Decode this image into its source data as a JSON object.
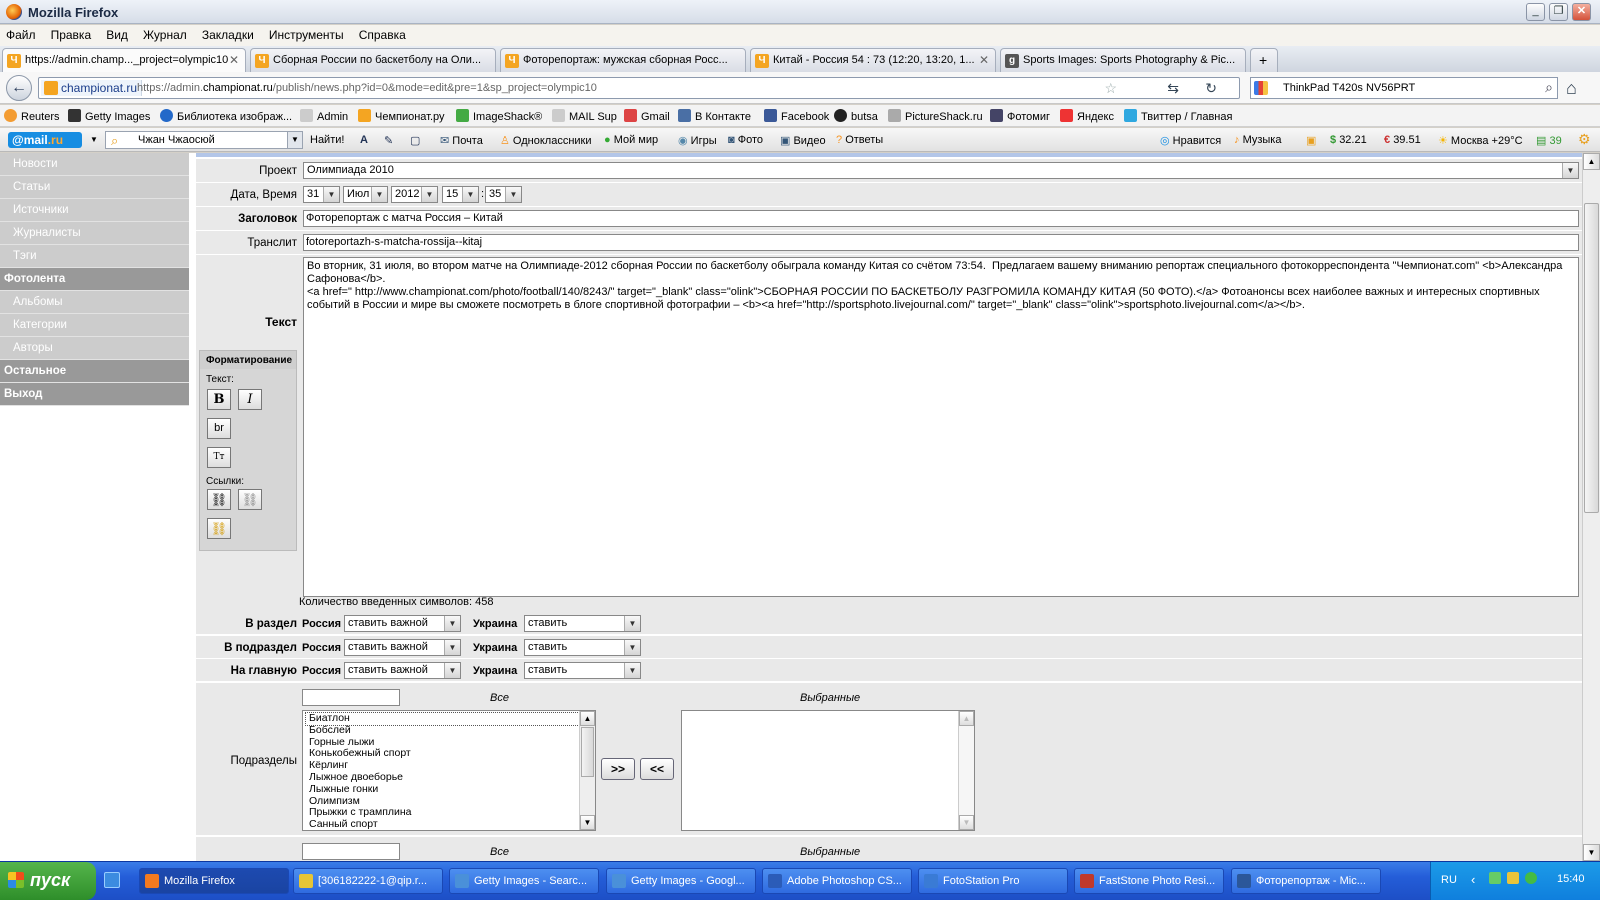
{
  "window": {
    "title": "Mozilla Firefox"
  },
  "menu": [
    "Файл",
    "Правка",
    "Вид",
    "Журнал",
    "Закладки",
    "Инструменты",
    "Справка"
  ],
  "tabs": [
    {
      "label": "https://admin.champ..._project=olympic10",
      "icon": "championat-icon"
    },
    {
      "label": "Сборная России по баскетболу на Оли...",
      "icon": "championat-icon"
    },
    {
      "label": "Фоторепортаж: мужская сборная Росс...",
      "icon": "championat-icon"
    },
    {
      "label": "Китай - Россия 54 : 73 (12:20, 13:20, 1...",
      "icon": "championat-icon"
    },
    {
      "label": "Sports Images: Sports Photography & Pic...",
      "icon": "getty-icon"
    }
  ],
  "nav": {
    "site": "championat.ru",
    "url_pre": "https://admin.",
    "url_host": "championat.ru",
    "url_post": "/publish/news.php?id=0&mode=edit&pre=1&sp_project=olympic10",
    "search_value": "ThinkPad T420s NV56PRT"
  },
  "bookmarks": [
    "Reuters",
    "Getty Images",
    "Библиотека изображ...",
    "Admin",
    "Чемпионат.ру",
    "ImageShack®",
    "MAIL Sup",
    "Gmail",
    "В Контакте",
    "Facebook",
    "butsa",
    "PictureShack.ru",
    "Фотомиг",
    "Яндекс",
    "Твиттер / Главная"
  ],
  "mailbar": {
    "logo_a": "@mail",
    "logo_b": ".ru",
    "user": "Чжан Чжаосюй",
    "find": "Найти!",
    "links": [
      "Почта",
      "Одноклассники",
      "Мой мир",
      "Игры",
      "Фото",
      "Видео",
      "Ответы",
      "Нравится",
      "Музыка"
    ],
    "usd": "32.21",
    "eur": "39.51",
    "weather": "Москва +29°C",
    "count": "39"
  },
  "sidebar": [
    {
      "label": "Новости",
      "header": false
    },
    {
      "label": "Статьи",
      "header": false
    },
    {
      "label": "Источники",
      "header": false
    },
    {
      "label": "Журналисты",
      "header": false
    },
    {
      "label": "Тэги",
      "header": false
    },
    {
      "label": "Фотолента",
      "header": true
    },
    {
      "label": "Альбомы",
      "header": false
    },
    {
      "label": "Категории",
      "header": false
    },
    {
      "label": "Авторы",
      "header": false
    },
    {
      "label": "Остальное",
      "header": true
    },
    {
      "label": "Выход",
      "header": true
    }
  ],
  "form": {
    "project_label": "Проект",
    "project_value": "Олимпиада 2010",
    "datetime_label": "Дата, Время",
    "day": "31",
    "month": "Июл",
    "year": "2012",
    "hour": "15",
    "minute": "35",
    "title_label": "Заголовок",
    "title_value": "Фоторепортаж с матча Россия – Китай",
    "translit_label": "Транслит",
    "translit_value": "fotoreportazh-s-matcha-rossija--kitaj",
    "text_label": "Текст",
    "text_value": "Во вторник, 31 июля, во втором матче на Олимпиаде-2012 сборная России по баскетболу обыграла команду Китая со счётом 73:54.  Предлагаем вашему вниманию репортаж специального фотокорреспондента \"Чемпионат.com\" <b>Александра Сафонова</b>.\n<a href=\" http://www.championat.com/photo/football/140/8243/\" target=\"_blank\" class=\"olink\">СБОРНАЯ РОССИИ ПО БАСКЕТБОЛУ РАЗГРОМИЛА КОМАНДУ КИТАЯ (50 ФОТО).</a> Фотоанонсы всех наиболее важных и интересных спортивных событий в России и мире вы сможете посмотреть в блоге спортивной фотографии – <b><a href=\"http://sportsphoto.livejournal.com/\" target=\"_blank\" class=\"olink\">sportsphoto.livejournal.com</a></b>.",
    "char_count": "Количество введенных символов: 458",
    "format_title": "Форматирование",
    "format_text_label": "Текст:",
    "format_links_label": "Ссылки:",
    "btn_bold": "B",
    "btn_italic": "I",
    "btn_br": "br",
    "btn_tt": "Tт"
  },
  "placement": [
    {
      "label": "В раздел",
      "russia_label": "Россия",
      "russia": "ставить важной",
      "ukraine_label": "Украина",
      "ukraine": "ставить"
    },
    {
      "label": "В подраздел",
      "russia_label": "Россия",
      "russia": "ставить важной",
      "ukraine_label": "Украина",
      "ukraine": "ставить"
    },
    {
      "label": "На главную",
      "russia_label": "Россия",
      "russia": "ставить важной",
      "ukraine_label": "Украина",
      "ukraine": "ставить"
    }
  ],
  "subsections": {
    "label": "Подразделы",
    "all_label": "Все",
    "selected_label": "Выбранные",
    "add_btn": ">>",
    "remove_btn": "<<",
    "items": [
      "Биатлон",
      "Бобслей",
      "Горные лыжи",
      "Конькобежный спорт",
      "Кёрлинг",
      "Лыжное двоеборье",
      "Лыжные гонки",
      "Олимпизм",
      "Прыжки с трамплина",
      "Санный спорт"
    ]
  },
  "taskbar": {
    "start": "пуск",
    "tasks": [
      "Mozilla Firefox",
      "[306182222-1@qip.r...",
      "Getty Images - Searc...",
      "Getty Images - Googl...",
      "Adobe Photoshop CS...",
      "FotoStation Pro",
      "FastStone Photo Resi...",
      "Фоторепортаж - Mic..."
    ],
    "lang": "RU",
    "clock": "15:40"
  }
}
